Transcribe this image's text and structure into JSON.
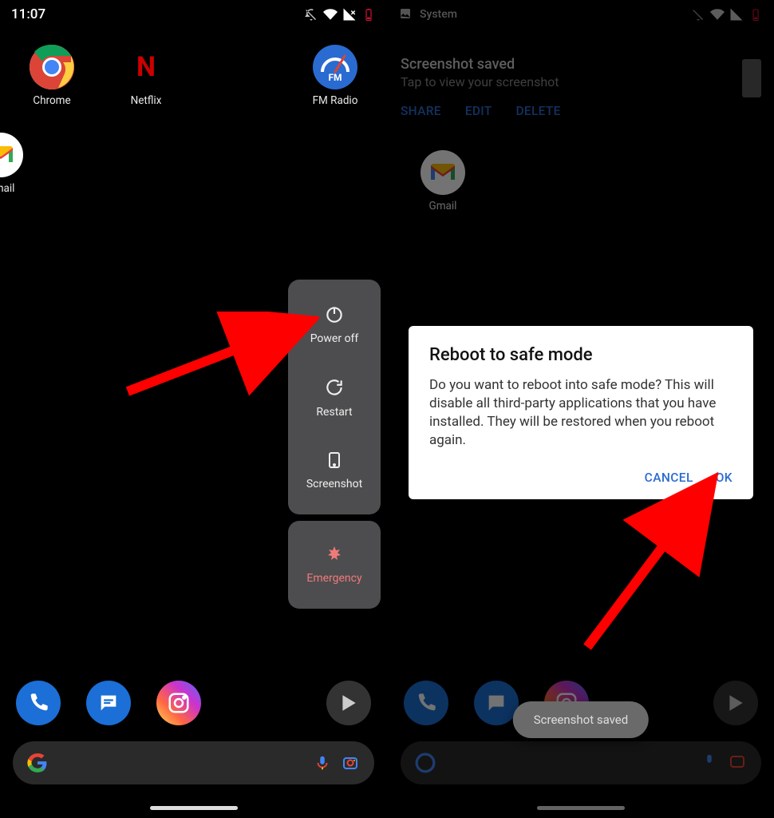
{
  "left": {
    "clock": "11:07",
    "apps": {
      "chrome": "Chrome",
      "netflix": "Netflix",
      "fmradio": "FM Radio",
      "fmradio_badge": "FM",
      "gmail": "Gmail"
    },
    "power_menu": {
      "power_off": "Power off",
      "restart": "Restart",
      "screenshot": "Screenshot",
      "emergency": "Emergency"
    }
  },
  "right": {
    "status_app": "System",
    "notification": {
      "title": "Screenshot saved",
      "subtitle": "Tap to view your screenshot",
      "share": "SHARE",
      "edit": "EDIT",
      "delete": "DELETE"
    },
    "gmail": "Gmail",
    "dialog": {
      "title": "Reboot to safe mode",
      "body": "Do you want to reboot into safe mode? This will disable all third-party applications that you have installed. They will be restored when you reboot again.",
      "cancel": "CANCEL",
      "ok": "OK"
    },
    "toast": "Screenshot saved"
  }
}
